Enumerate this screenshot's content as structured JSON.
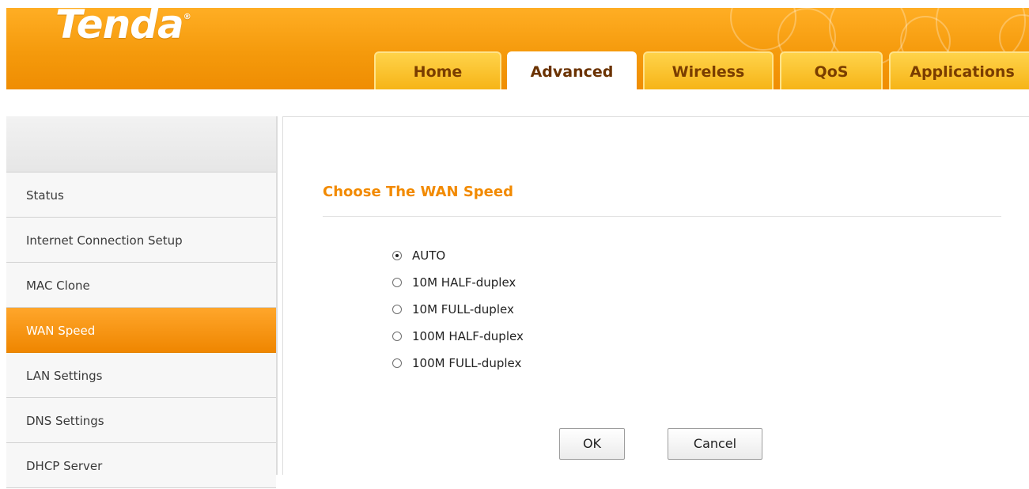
{
  "header": {
    "logo": "Tenda",
    "logo_mark": "®",
    "tabs": [
      {
        "label": "Home",
        "active": false
      },
      {
        "label": "Advanced",
        "active": true
      },
      {
        "label": "Wireless",
        "active": false
      },
      {
        "label": "QoS",
        "active": false
      },
      {
        "label": "Applications",
        "active": false
      }
    ]
  },
  "sidebar": {
    "items": [
      {
        "label": "Status"
      },
      {
        "label": "Internet Connection Setup"
      },
      {
        "label": "MAC Clone"
      },
      {
        "label": "WAN Speed",
        "active": true
      },
      {
        "label": "LAN Settings"
      },
      {
        "label": "DNS Settings"
      },
      {
        "label": "DHCP Server"
      }
    ]
  },
  "main": {
    "title": "Choose The WAN Speed",
    "options": [
      {
        "label": "AUTO",
        "checked": true
      },
      {
        "label": "10M HALF-duplex",
        "checked": false
      },
      {
        "label": "10M FULL-duplex",
        "checked": false
      },
      {
        "label": "100M HALF-duplex",
        "checked": false
      },
      {
        "label": "100M FULL-duplex",
        "checked": false
      }
    ],
    "ok_label": "OK",
    "cancel_label": "Cancel"
  },
  "colors": {
    "brand_orange": "#f59a0c",
    "title_orange": "#f28a00",
    "active_menu": "#ef8600"
  }
}
